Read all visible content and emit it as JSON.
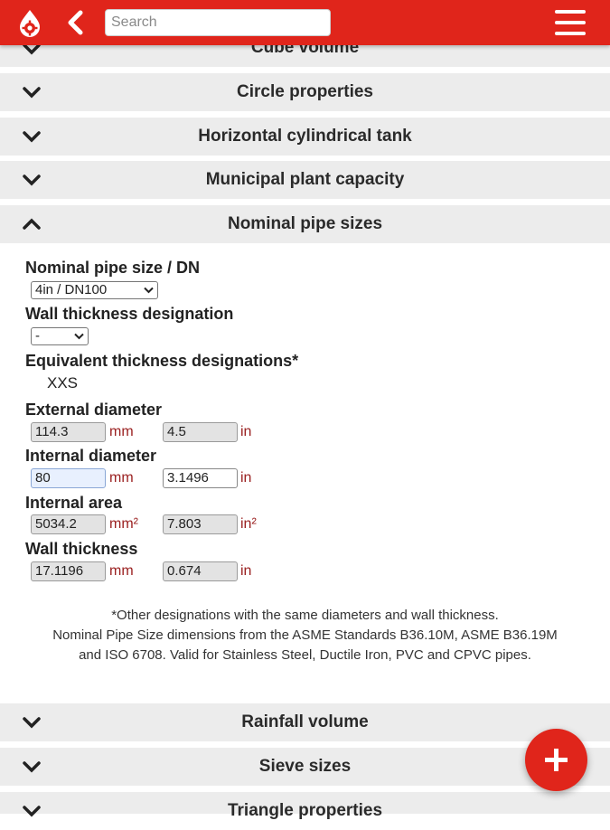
{
  "header": {
    "search_placeholder": "Search",
    "icons": {
      "logo": "drop-gear-icon",
      "back": "chevron-left-icon",
      "menu": "hamburger-menu-icon"
    },
    "color": "#e0251b"
  },
  "accordion": {
    "top_items": [
      "Cube volume",
      "Circle properties",
      "Horizontal cylindrical tank",
      "Municipal plant capacity"
    ],
    "open_item": "Nominal pipe sizes",
    "bottom_items": [
      "Rainfall volume",
      "Sieve sizes",
      "Triangle properties"
    ]
  },
  "form": {
    "pipe_size_label": "Nominal pipe size / DN",
    "pipe_size_value": "4in / DN100",
    "wall_designation_label": "Wall thickness designation",
    "wall_designation_value": "-",
    "equiv_label": "Equivalent thickness designations*",
    "equiv_value": "XXS",
    "external_diameter": {
      "label": "External diameter",
      "mm": "114.3",
      "mm_unit": "mm",
      "in": "4.5",
      "in_unit": "in"
    },
    "internal_diameter": {
      "label": "Internal diameter",
      "mm": "80",
      "mm_unit": "mm",
      "in": "3.1496",
      "in_unit": "in"
    },
    "internal_area": {
      "label": "Internal area",
      "mm": "5034.2",
      "mm_unit": "mm²",
      "in": "7.803",
      "in_unit": "in²"
    },
    "wall_thickness": {
      "label": "Wall thickness",
      "mm": "17.1196",
      "mm_unit": "mm",
      "in": "0.674",
      "in_unit": "in"
    }
  },
  "notes": {
    "line1": "*Other designations with the same diameters and wall thickness.",
    "line2": "Nominal Pipe Size dimensions from the ASME Standards B36.10M, ASME B36.19M",
    "line3": "and ISO 6708. Valid for Stainless Steel, Ductile Iron, PVC and CPVC pipes."
  },
  "fab": {
    "icon": "plus-icon"
  }
}
